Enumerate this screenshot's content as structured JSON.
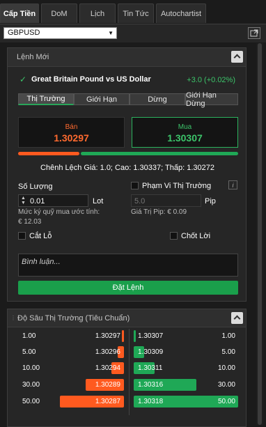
{
  "tabs": [
    "Cấp Tiền",
    "DoM",
    "Lịch",
    "Tin Tức",
    "Autochartist"
  ],
  "symbol_select": "GBPUSD",
  "new_order": {
    "panel_title": "Lệnh Mới",
    "instrument": "Great Britain Pound vs US Dollar",
    "change": "+3.0 (+0.02%)",
    "order_types": [
      "Thị Trường",
      "Giới Hạn",
      "Dừng",
      "Giới Hạn Dừng"
    ],
    "sell_label": "Bán",
    "sell_price": "1.30297",
    "buy_label": "Mua",
    "buy_price": "1.30307",
    "spread_text": "Chênh Lệch Giá: 1.0; Cao: 1.30337; Thấp: 1.30272",
    "quantity_label": "Số Lượng",
    "quantity_value": "0.01",
    "quantity_unit": "Lot",
    "range_label": "Phạm Vi Thị Trường",
    "range_value": "5.0",
    "range_unit": "Pip",
    "margin_label": "Mức ký quỹ mua ước tính:",
    "margin_value": "€ 12.03",
    "pip_value": "Giá Trị Pip: € 0.09",
    "stop_loss": "Cắt Lỗ",
    "take_profit": "Chốt Lời",
    "comment_placeholder": "Bình luận...",
    "place_order": "Đặt Lệnh"
  },
  "depth": {
    "panel_title": "Độ Sâu Thị Trường (Tiêu Chuẩn)",
    "bids": [
      {
        "volume": "1.00",
        "price": "1.30297",
        "fill": 0.02
      },
      {
        "volume": "5.00",
        "price": "1.30296",
        "fill": 0.1
      },
      {
        "volume": "10.00",
        "price": "1.30294",
        "fill": 0.2
      },
      {
        "volume": "30.00",
        "price": "1.30289",
        "fill": 0.6
      },
      {
        "volume": "50.00",
        "price": "1.30287",
        "fill": 1.0
      }
    ],
    "asks": [
      {
        "price": "1.30307",
        "volume": "1.00",
        "fill": 0.02
      },
      {
        "price": "1.30309",
        "volume": "5.00",
        "fill": 0.1
      },
      {
        "price": "1.30311",
        "volume": "10.00",
        "fill": 0.2
      },
      {
        "price": "1.30316",
        "volume": "30.00",
        "fill": 0.6
      },
      {
        "price": "1.30318",
        "volume": "50.00",
        "fill": 1.0
      }
    ]
  },
  "colors": {
    "sell": "#ff5a1f",
    "buy": "#1fa856",
    "change": "#3cc46a"
  }
}
